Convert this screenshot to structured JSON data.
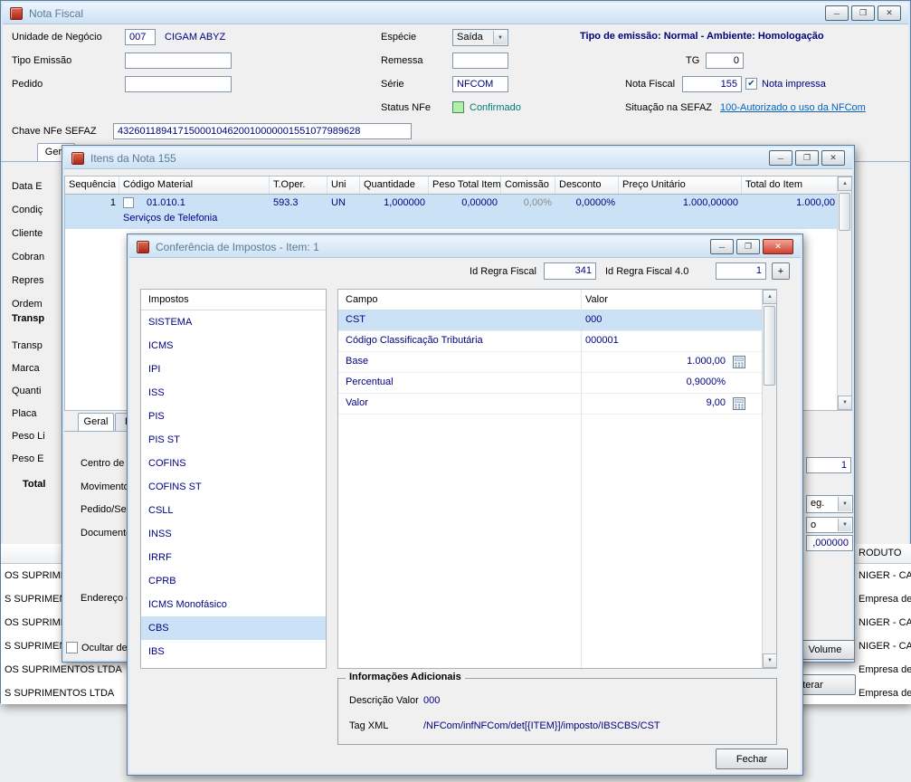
{
  "icons": {
    "minimize": "─",
    "maximize": "❐",
    "close": "✕",
    "dropdown": "▼",
    "up": "▲",
    "down": "▼",
    "check": "✔"
  },
  "main_window": {
    "title": "Nota Fiscal",
    "fields": {
      "unidade_label": "Unidade de Negócio",
      "unidade_code": "007",
      "unidade_name": "CIGAM ABYZ",
      "especie_label": "Espécie",
      "especie_value": "Saída",
      "banner": "Tipo de emissão: Normal - Ambiente: Homologação",
      "tipo_emissao_label": "Tipo Emissão",
      "remessa_label": "Remessa",
      "tg_label": "TG",
      "tg_value": "0",
      "pedido_label": "Pedido",
      "serie_label": "Série",
      "serie_value": "NFCOM",
      "nota_fiscal_label": "Nota Fiscal",
      "nota_fiscal_value": "155",
      "nota_impressa_label": "Nota impressa",
      "status_label": "Status NFe",
      "status_value": "Confirmado",
      "situacao_label": "Situação na SEFAZ",
      "situacao_link": "100-Autorizado o uso da NFCom",
      "chave_label": "Chave NFe SEFAZ",
      "chave_value": "43260118941715000104620010000001551077989628"
    },
    "tab_label": "Gera",
    "left_labels": [
      "Data E",
      "Condiç",
      "Cliente",
      "Cobran",
      "Repres",
      "Ordem"
    ],
    "transporte_group_label": "Transp",
    "transporte_labels": [
      "Transp",
      "Marca",
      "Quanti",
      "Placa",
      "Peso Li",
      "Peso E"
    ],
    "total_label": "Total",
    "grid": {
      "header_fragment": "RODUTO",
      "left_rows": [
        "OS SUPRIMENTOS LTDA",
        "S SUPRIMENTOS LTDA",
        "OS SUPRIMENTOS LTDA",
        "S SUPRIMENTOS LTDA",
        "OS SUPRIMENTOS LTDA",
        "S SUPRIMENTOS LTDA"
      ],
      "right_rows": [
        "NIGER - CA",
        "Empresa de C",
        "NIGER - CA",
        "NIGER - CA",
        "Empresa de C",
        "Empresa de C"
      ],
      "alterar_fragment": "terar"
    }
  },
  "itens_window": {
    "title": "Itens da Nota 155",
    "columns": [
      "Sequência",
      "Código Material",
      "T.Oper.",
      "Uni",
      "Quantidade",
      "Peso Total Item",
      "Comissão",
      "Desconto",
      "Preço Unitário",
      "Total do Item"
    ],
    "item": {
      "sequencia": "1",
      "codigo": "01.010.1",
      "descricao": "Serviços de Telefonia",
      "t_oper": "593.3",
      "uni": "UN",
      "quantidade": "1,000000",
      "peso_total": "0,00000",
      "comissao": "0,00%",
      "desconto": "0,0000%",
      "preco_unitario": "1.000,00000",
      "total": "1.000,00"
    },
    "tabs": [
      "Geral",
      "Imp"
    ],
    "detail_labels": [
      "Centro de",
      "Movimento",
      "Pedido/Seq",
      "Documento"
    ],
    "endereco_label": "Endereço c",
    "ocultar_label": "Ocultar de",
    "fragments": {
      "field1": "1",
      "combo_eg": "eg.",
      "combo_o": "o",
      "field_num": ",000000"
    },
    "volume_button": "Volume"
  },
  "conf_window": {
    "title": "Conferência de Impostos - Item: 1",
    "id_regra_label": "Id Regra Fiscal",
    "id_regra_value": "341",
    "id_regra40_label": "Id Regra Fiscal 4.0",
    "id_regra40_value": "1",
    "plus_button": "+",
    "impostos_header": "Impostos",
    "impostos": [
      {
        "label": "SISTEMA"
      },
      {
        "label": "ICMS"
      },
      {
        "label": "IPI"
      },
      {
        "label": "ISS"
      },
      {
        "label": "PIS"
      },
      {
        "label": "PIS ST"
      },
      {
        "label": "COFINS"
      },
      {
        "label": "COFINS ST"
      },
      {
        "label": "CSLL"
      },
      {
        "label": "INSS"
      },
      {
        "label": "IRRF"
      },
      {
        "label": "CPRB"
      },
      {
        "label": "ICMS Monofásico"
      },
      {
        "label": "CBS",
        "selected": true
      },
      {
        "label": "IBS"
      }
    ],
    "table_headers": {
      "campo": "Campo",
      "valor": "Valor"
    },
    "rows": [
      {
        "campo": "CST",
        "valor": "000",
        "selected": true
      },
      {
        "campo": "Código Classificação Tributária",
        "valor": "000001"
      },
      {
        "campo": "Base",
        "valor": "1.000,00",
        "num": true,
        "calc": true
      },
      {
        "campo": "Percentual",
        "valor": "0,9000%",
        "num": true
      },
      {
        "campo": "Valor",
        "valor": "9,00",
        "num": true,
        "calc": true
      }
    ],
    "info": {
      "title": "Informações Adicionais",
      "descricao_label": "Descrição Valor",
      "descricao_value": "000",
      "tag_label": "Tag XML",
      "tag_value": "/NFCom/infNFCom/det[{ITEM}]/imposto/IBSCBS/CST"
    },
    "fechar_button": "Fechar"
  }
}
